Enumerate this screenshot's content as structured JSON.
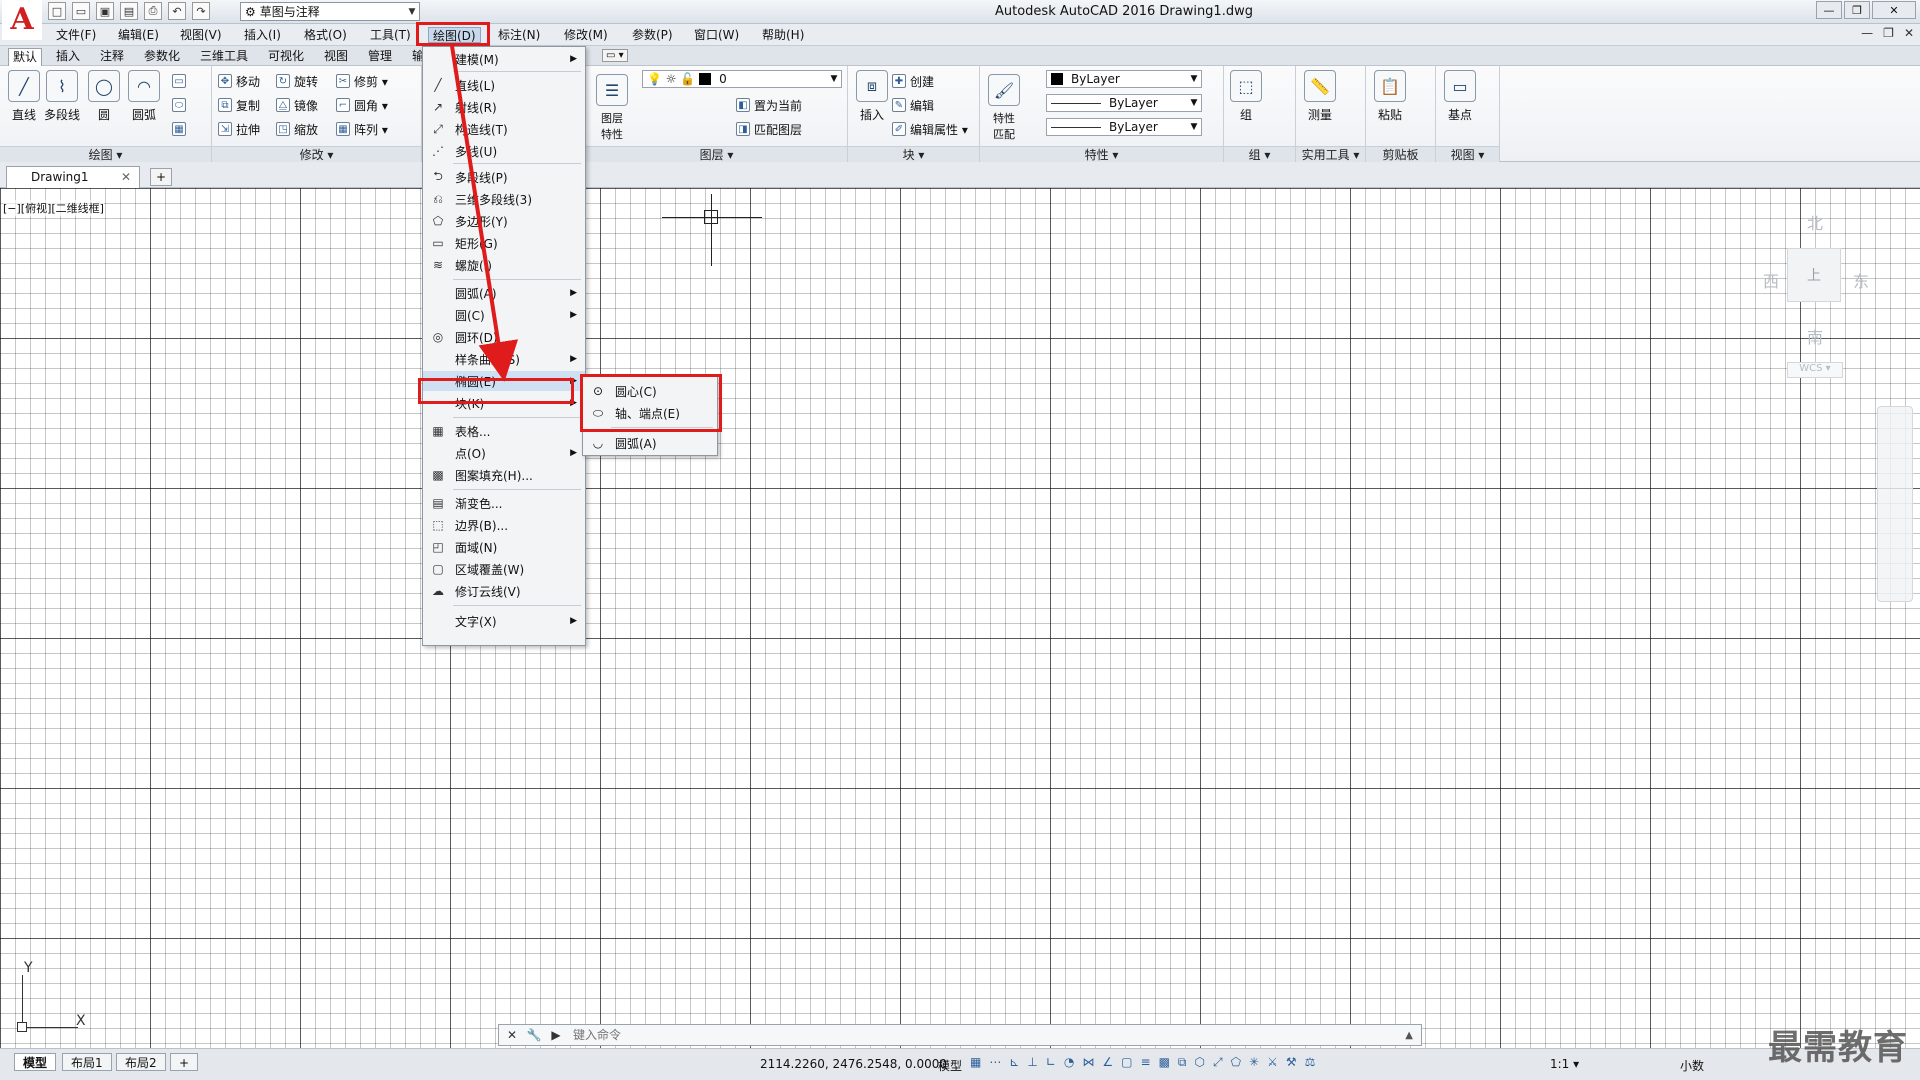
{
  "title_bar": {
    "app_title": "Autodesk AutoCAD 2016    Drawing1.dwg",
    "workspace": "草图与注释",
    "logo_letter": "A",
    "window_controls": [
      "—",
      "❐",
      "✕"
    ]
  },
  "menubar": {
    "items": [
      "文件(F)",
      "编辑(E)",
      "视图(V)",
      "插入(I)",
      "格式(O)",
      "工具(T)",
      "绘图(D)",
      "标注(N)",
      "修改(M)",
      "参数(P)",
      "窗口(W)",
      "帮助(H)"
    ],
    "active": "绘图(D)",
    "doc_controls": [
      "—",
      "❐",
      "✕"
    ]
  },
  "ribbon_tabs": [
    "默认",
    "插入",
    "注释",
    "参数化",
    "三维工具",
    "可视化",
    "视图",
    "管理",
    "输"
  ],
  "ribbon": {
    "draw": {
      "big_buttons": [
        "直线",
        "多段线",
        "圆",
        "圆弧"
      ],
      "footer": "绘图 ▾"
    },
    "modify": {
      "buttons": [
        "移动",
        "旋转",
        "修剪 ▾",
        "复制",
        "镜像",
        "圆角 ▾",
        "拉伸",
        "缩放",
        "阵列 ▾"
      ],
      "footer": "修改 ▾"
    },
    "layers": {
      "big": "图层\n特性",
      "layer_name": "0",
      "buttons": [
        "置为当前",
        "匹配图层"
      ],
      "footer": "图层 ▾"
    },
    "block": {
      "big": "插入",
      "buttons": [
        "创建",
        "编辑",
        "编辑属性 ▾"
      ],
      "footer": "块 ▾"
    },
    "properties": {
      "big": "特性\n匹配",
      "selects": [
        "ByLayer",
        "ByLayer",
        "ByLayer"
      ],
      "footer": "特性 ▾"
    },
    "group": {
      "big": "组",
      "footer": "组 ▾"
    },
    "utilities": {
      "big": "测量",
      "footer": "实用工具 ▾"
    },
    "clipboard": {
      "big": "粘贴",
      "footer": "剪贴板"
    },
    "view": {
      "big": "基点",
      "footer": "视图 ▾"
    }
  },
  "doc_tab": {
    "name": "Drawing1",
    "close": "✕",
    "new": "+"
  },
  "viewport_label": "[−][俯视][二维线框]",
  "viewcube": {
    "north": "北",
    "west": "西",
    "east": "东",
    "south": "南",
    "top": "上",
    "wcs": "WCS ▾"
  },
  "ucs": {
    "x": "X",
    "y": "Y"
  },
  "draw_menu": {
    "items": [
      {
        "label": "建模(M)",
        "submenu": true
      },
      {
        "label": "直线(L)"
      },
      {
        "label": "射线(R)"
      },
      {
        "label": "构造线(T)"
      },
      {
        "label": "多线(U)"
      },
      {
        "label": "多段线(P)"
      },
      {
        "label": "三维多段线(3)"
      },
      {
        "label": "多边形(Y)"
      },
      {
        "label": "矩形(G)"
      },
      {
        "label": "螺旋(I)"
      },
      {
        "label": "圆弧(A)",
        "submenu": true
      },
      {
        "label": "圆(C)",
        "submenu": true
      },
      {
        "label": "圆环(D)"
      },
      {
        "label": "样条曲线(S)",
        "submenu": true
      },
      {
        "label": "椭圆(E)",
        "submenu": true
      },
      {
        "label": "块(K)",
        "submenu": true
      },
      {
        "label": "表格..."
      },
      {
        "label": "点(O)",
        "submenu": true
      },
      {
        "label": "图案填充(H)..."
      },
      {
        "label": "渐变色..."
      },
      {
        "label": "边界(B)..."
      },
      {
        "label": "面域(N)"
      },
      {
        "label": "区域覆盖(W)"
      },
      {
        "label": "修订云线(V)"
      },
      {
        "label": "文字(X)",
        "submenu": true
      }
    ]
  },
  "ellipse_submenu": {
    "items": [
      "圆心(C)",
      "轴、端点(E)",
      "圆弧(A)"
    ]
  },
  "command_line": {
    "placeholder": "键入命令"
  },
  "status_bar": {
    "layout_tabs": [
      "模型",
      "布局1",
      "布局2"
    ],
    "new_tab": "+",
    "coords": "2114.2260, 2476.2548, 0.0000",
    "mode": "模型",
    "scale": "1:1 ▾",
    "units": "小数"
  },
  "watermark": "最需教育",
  "colors": {
    "annotation": "#e01b1b",
    "logo": "#d11f1f"
  }
}
